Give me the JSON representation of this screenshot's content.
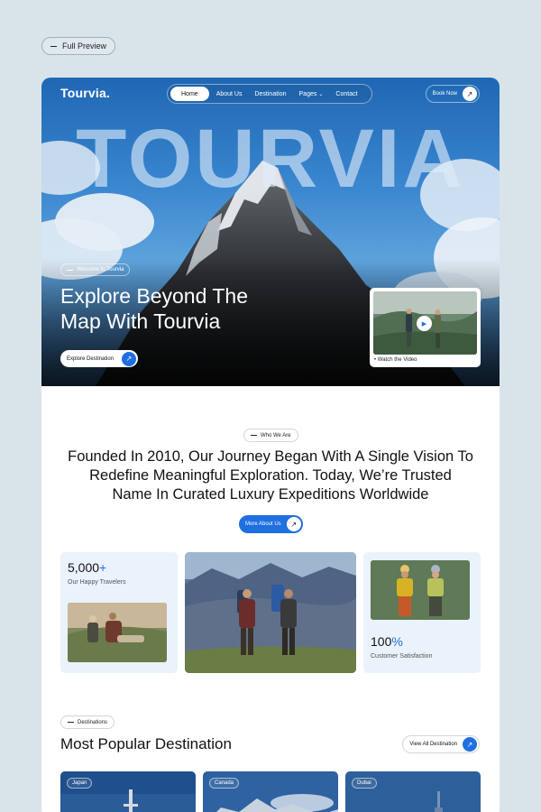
{
  "preview": {
    "label": "Full Preview"
  },
  "header": {
    "brand": "Tourvia.",
    "nav": [
      {
        "label": "Home",
        "active": true
      },
      {
        "label": "About Us"
      },
      {
        "label": "Destination"
      },
      {
        "label": "Pages",
        "has_dropdown": true
      },
      {
        "label": "Contact"
      }
    ],
    "book_button": "Book Now"
  },
  "hero": {
    "big_word": "TOURVIA",
    "welcome_tag": "Welcome to Tourvia",
    "headline_line1": "Explore Beyond The",
    "headline_line2": "Map With Tourvia",
    "cta": "Explore Destination",
    "video_label": "Watch the Video"
  },
  "about": {
    "tag": "Who We Are",
    "text_line1": "Founded In 2010, Our Journey Began With A Single Vision To",
    "text_line2": "Redefine Meaningful Exploration. Today, We’re Trusted",
    "text_line3": "Name In Curated Luxury Expeditions Worldwide",
    "button": "More About Us"
  },
  "stats": [
    {
      "number": "5,000",
      "suffix": "+",
      "label": "Our Happy Travelers"
    },
    {
      "number": "100",
      "suffix": "%",
      "label": "Customer Satisfaction"
    }
  ],
  "destinations": {
    "tag": "Destinations",
    "title": "Most Popular Destination",
    "view_all": "View All Destination",
    "cards": [
      {
        "name": "Japan"
      },
      {
        "name": "Canada"
      },
      {
        "name": "Dubai"
      }
    ]
  },
  "colors": {
    "accent": "#1f6fe0",
    "stat_bg": "#eaf2fb",
    "page_bg": "#d9e4ea"
  },
  "icons": {
    "arrow": "arrow-up-right-icon",
    "play": "play-icon",
    "chevron": "chevron-down-icon"
  }
}
